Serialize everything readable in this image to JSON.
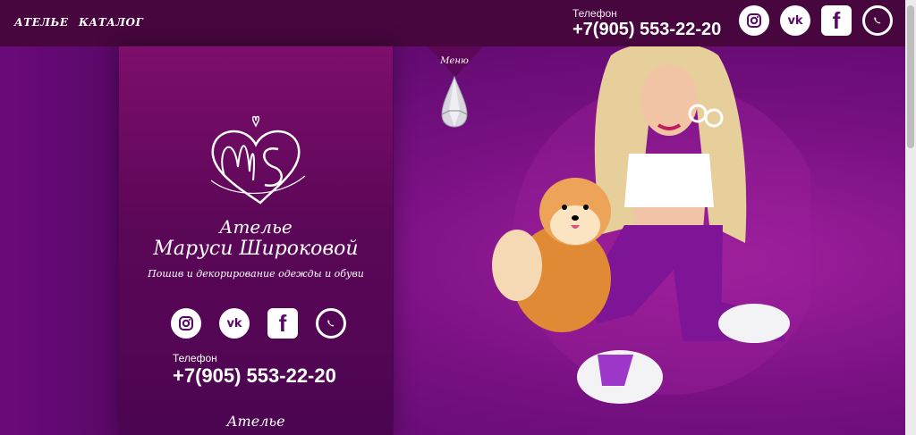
{
  "nav": {
    "items": [
      {
        "label": "АТЕЛЬЕ"
      },
      {
        "label": "КАТАЛОГ"
      }
    ]
  },
  "header": {
    "phone_label": "Телефон",
    "phone": "+7(905) 553-22-20",
    "social": [
      "instagram-icon",
      "vk-icon",
      "facebook-icon",
      "whatsapp-icon"
    ]
  },
  "menu": {
    "label": "Меню"
  },
  "panel": {
    "name_line1": "Ателье",
    "name_line2": "Маруси Широковой",
    "tagline": "Пошив и декорирование одежды и обуви",
    "phone_label": "Телефон",
    "phone": "+7(905) 553-22-20",
    "footer_link": "Ателье",
    "social": [
      "instagram-icon",
      "vk-icon",
      "facebook-icon",
      "whatsapp-icon"
    ]
  },
  "colors": {
    "topbar": "#47063e",
    "panel": "#5c0758",
    "background": "#6e0d7c"
  }
}
